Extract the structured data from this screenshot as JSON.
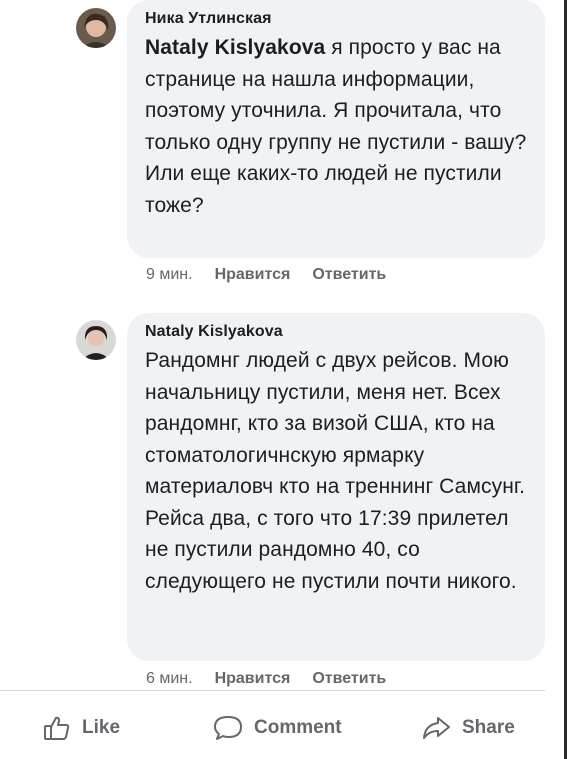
{
  "comments": [
    {
      "author": "Ника Утлинская",
      "mention": "Nataly Kislyakova",
      "text": " я просто у вас на странице на нашла информации, поэтому уточнила. Я прочитала, что только одну группу не пустили - вашу? Или еще каких-то людей не пустили тоже?",
      "time": "9 мин.",
      "like_label": "Нравится",
      "reply_label": "Ответить"
    },
    {
      "author": "Nataly Kislyakova",
      "text": "Рандомнг людей с двух рейсов. Мою начальницу пустили, меня нет. Всех рандомнг, кто за визой США, кто на стоматологичнскую ярмарку материаловч кто на треннинг Самсунг. Рейса два, с того что 17:39 прилетел не пустили рандомно 40, со следующего не пустили почти никого.",
      "time": "6 мин.",
      "like_label": "Нравится",
      "reply_label": "Ответить"
    }
  ],
  "action_bar": {
    "like_label": "Like",
    "comment_label": "Comment",
    "share_label": "Share",
    "like_icon": "thumbs-up-icon",
    "comment_icon": "speech-bubble-icon",
    "share_icon": "share-arrow-icon"
  },
  "colors": {
    "bubble": "#f0f2f5",
    "text": "#1c1e21",
    "secondary": "#65676b"
  }
}
